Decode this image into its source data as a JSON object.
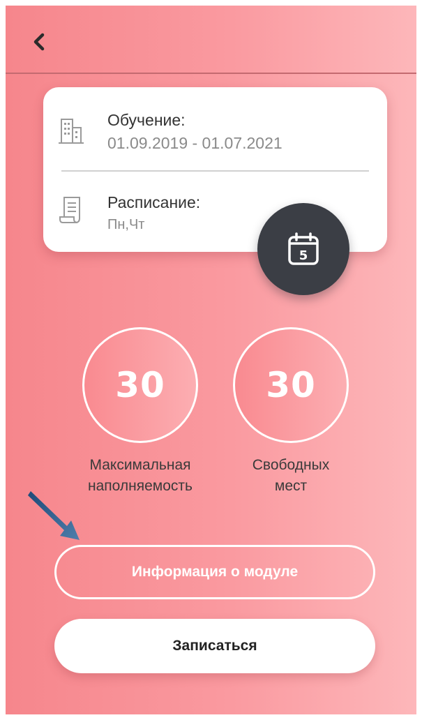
{
  "nav": {
    "back_icon": "chevron-left-icon"
  },
  "card": {
    "study": {
      "icon": "building-icon",
      "title": "Обучение:",
      "value": "01.09.2019 - 01.07.2021"
    },
    "schedule": {
      "icon": "document-icon",
      "title": "Расписание:",
      "value": "Пн,Чт"
    },
    "calendar_button": {
      "icon": "calendar-icon",
      "day": "5"
    }
  },
  "stats": [
    {
      "value": "30",
      "label": "Максимальная\nнаполняемость"
    },
    {
      "value": "30",
      "label": "Свободных\nмест"
    }
  ],
  "buttons": {
    "info": "Информация о модуле",
    "enroll": "Записаться"
  },
  "colors": {
    "bg_start": "#f6868c",
    "bg_end": "#fdb7ba",
    "calendar_button": "#3b3e45",
    "pointer_arrow": "#2f5a85"
  }
}
